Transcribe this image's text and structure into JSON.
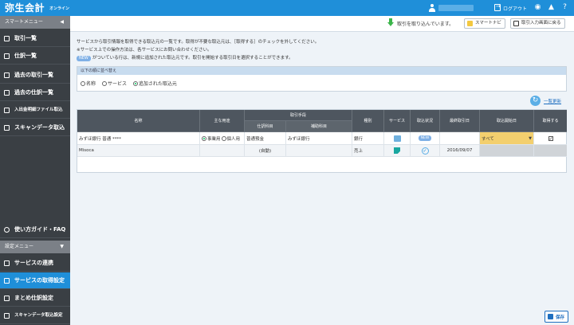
{
  "header": {
    "logo": "弥生会計",
    "logo_sub": "オンライン",
    "logout": "ログアウト",
    "icons": [
      "user-icon",
      "logout-icon",
      "chat-icon",
      "bell-icon",
      "help-icon"
    ]
  },
  "sidebar": {
    "smart_menu": "スマートメニュー",
    "items": [
      {
        "label": "取引一覧",
        "icon": "list-icon"
      },
      {
        "label": "仕訳一覧",
        "icon": "list-icon"
      },
      {
        "label": "過去の取引一覧",
        "icon": "list-icon"
      },
      {
        "label": "過去の仕訳一覧",
        "icon": "list-icon"
      },
      {
        "label": "入出金明細ファイル取込",
        "icon": "file-icon"
      },
      {
        "label": "スキャンデータ取込",
        "icon": "scan-icon"
      }
    ],
    "guide": "使い方ガイド・FAQ",
    "settings_menu": "設定メニュー",
    "settings_items": [
      {
        "label": "サービスの連携",
        "icon": "link-icon"
      },
      {
        "label": "サービスの取得設定",
        "icon": "gear-icon"
      },
      {
        "label": "まとめ仕訳設定",
        "icon": "merge-icon"
      },
      {
        "label": "スキャンデータ取込設定",
        "icon": "scan-icon"
      }
    ]
  },
  "toolbar": {
    "status": "取引を取り込んでいます。",
    "smart_navi": "スマートナビ",
    "back_to_input": "取引入力画面に戻る"
  },
  "description": {
    "line1": "サービスから取引情報を取得できる取込元の一覧です。取得が不要な取込元は、［取得する］のチェックを外してください。",
    "line2": "※サービス上での操作方法は、各サービスにお問い合わせください。",
    "line3_badge": "NEW",
    "line3": "がついている行は、新規に追加された取込元です。取引を開始する取引日を選択することができます。"
  },
  "sort": {
    "heading": "以下の順に並べ替え",
    "options": [
      "名称",
      "サービス",
      "追加された取込元"
    ],
    "selected_index": 2
  },
  "refresh_link": "一覧更新",
  "table": {
    "headers": {
      "name": "名称",
      "owner": "主な用途",
      "account_group": "取引手段",
      "debit": "仕訳科目",
      "credit": "補助科目",
      "type": "種別",
      "service": "サービス",
      "status": "取込状況",
      "last_date": "最終取引日",
      "start_date": "取込開始日",
      "fetch": "取得する"
    },
    "rows": [
      {
        "name": "みずほ銀行 普通 ****",
        "usage_business": "事業用",
        "usage_personal": "個人用",
        "debit": "普通預金",
        "credit": "みずほ銀行",
        "type": "銀行",
        "status": "NEW",
        "last_date": "",
        "start_date": "すべて",
        "fetch": "✓"
      },
      {
        "name": "Misoca",
        "usage_business": "",
        "usage_personal": "",
        "debit": "(自動)",
        "credit": "",
        "type": "売上",
        "status": "",
        "last_date": "2016/09/07",
        "start_date": "",
        "fetch": ""
      }
    ]
  },
  "save": "保存"
}
